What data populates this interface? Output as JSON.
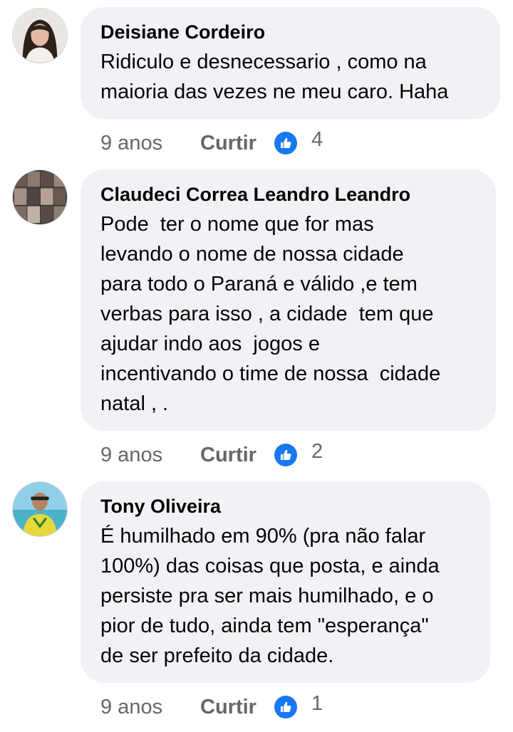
{
  "colors": {
    "bubble_bg": "#f0f2f5",
    "meta_text": "#65676b",
    "like_blue": "#1877f2",
    "name_text": "#050505"
  },
  "icons": {
    "reaction": "thumbs-up-icon"
  },
  "comments": [
    {
      "author": "Deisiane Cordeiro",
      "lines": [
        "Ridiculo e desnecessario , como na",
        "maioria das vezes ne meu caro. Haha"
      ],
      "time": "9 anos",
      "like_label": "Curtir",
      "reaction_count": "4"
    },
    {
      "author": "Claudeci Correa Leandro Leandro",
      "lines": [
        "Pode  ter o nome que for mas",
        "levando o nome de nossa cidade",
        "para todo o Paraná e válido ,e tem",
        "verbas para isso , a cidade  tem que",
        "ajudar indo aos  jogos e",
        "incentivando o time de nossa  cidade",
        "natal , ."
      ],
      "time": "9 anos",
      "like_label": "Curtir",
      "reaction_count": "2"
    },
    {
      "author": "Tony Oliveira",
      "lines": [
        "É humilhado em 90% (pra não falar",
        "100%) das coisas que posta, e ainda",
        "persiste pra ser mais humilhado, e o",
        "pior de tudo, ainda tem \"esperança\"",
        "de ser prefeito da cidade."
      ],
      "time": "9 anos",
      "like_label": "Curtir",
      "reaction_count": "1"
    }
  ]
}
